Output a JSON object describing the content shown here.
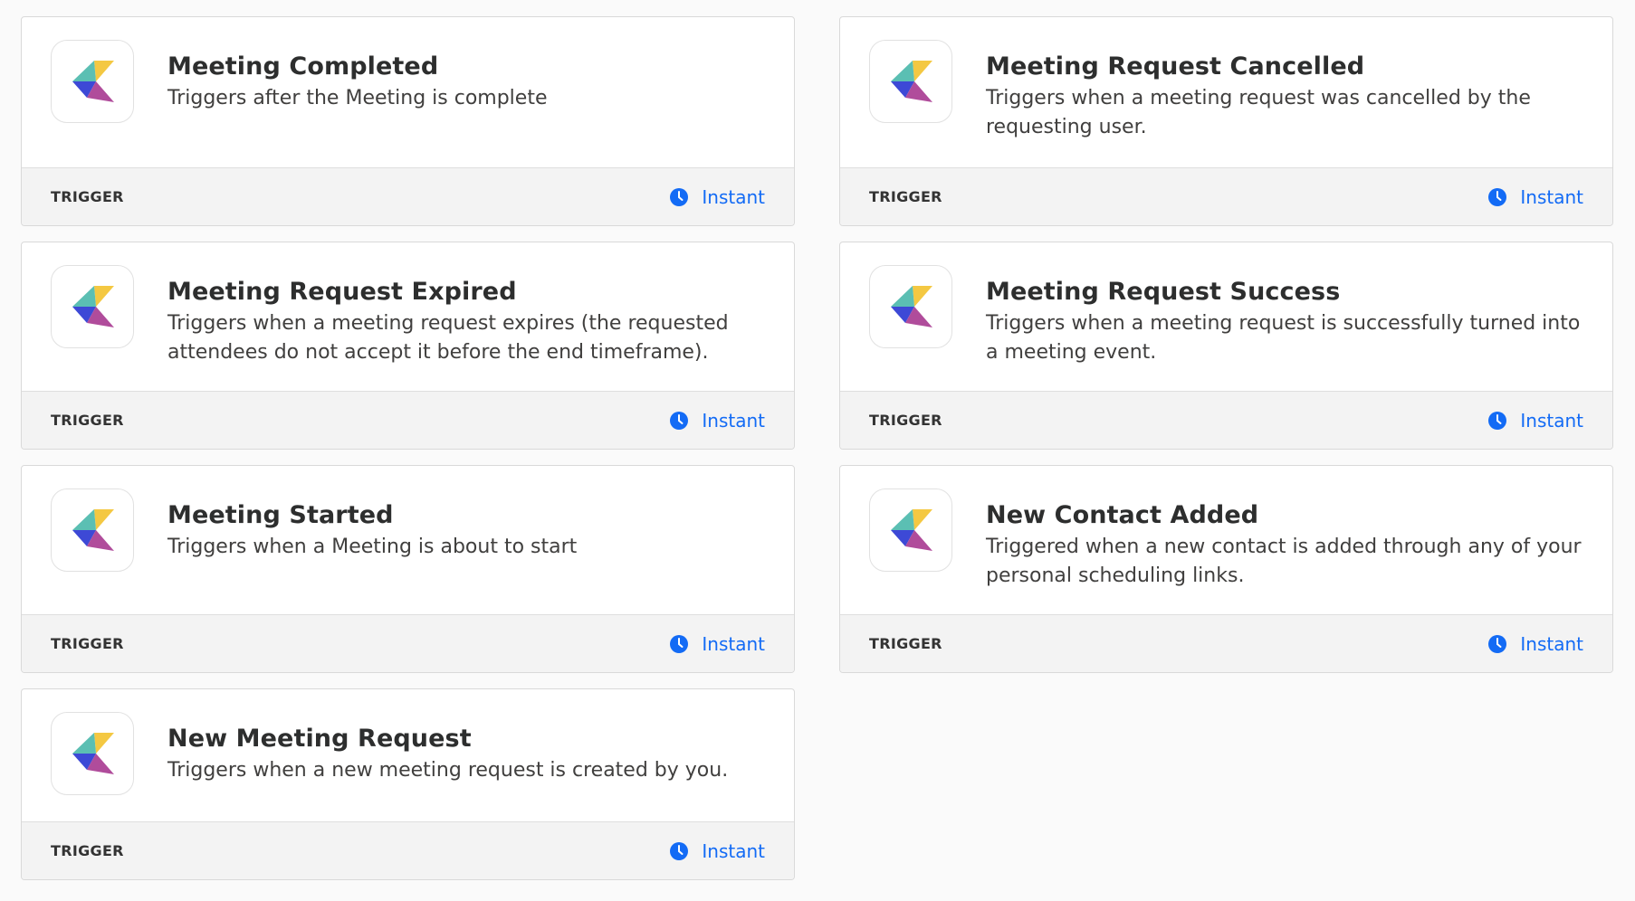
{
  "colors": {
    "accent": "#136bf5",
    "logo_yellow": "#f4c842",
    "logo_teal": "#5bbfb3",
    "logo_blue": "#3d49d6",
    "logo_magenta": "#b04c9b"
  },
  "cards": [
    {
      "title": "Meeting Completed",
      "description": "Triggers after the Meeting is complete",
      "type": "TRIGGER",
      "badge": "Instant",
      "icon": "clock-icon"
    },
    {
      "title": "Meeting Request Cancelled",
      "description": "Triggers when a meeting request was cancelled by the requesting user.",
      "type": "TRIGGER",
      "badge": "Instant",
      "icon": "clock-icon"
    },
    {
      "title": "Meeting Request Expired",
      "description": "Triggers when a meeting request expires (the requested attendees do not accept it before the end timeframe).",
      "type": "TRIGGER",
      "badge": "Instant",
      "icon": "clock-icon"
    },
    {
      "title": "Meeting Request Success",
      "description": "Triggers when a meeting request is successfully turned into a meeting event.",
      "type": "TRIGGER",
      "badge": "Instant",
      "icon": "clock-icon"
    },
    {
      "title": "Meeting Started",
      "description": "Triggers when a Meeting is about to start",
      "type": "TRIGGER",
      "badge": "Instant",
      "icon": "clock-icon"
    },
    {
      "title": "New Contact Added",
      "description": "Triggered when a new contact is added through any of your personal scheduling links.",
      "type": "TRIGGER",
      "badge": "Instant",
      "icon": "clock-icon"
    },
    {
      "title": "New Meeting Request",
      "description": "Triggers when a new meeting request is created by you.",
      "type": "TRIGGER",
      "badge": "Instant",
      "icon": "clock-icon"
    }
  ]
}
